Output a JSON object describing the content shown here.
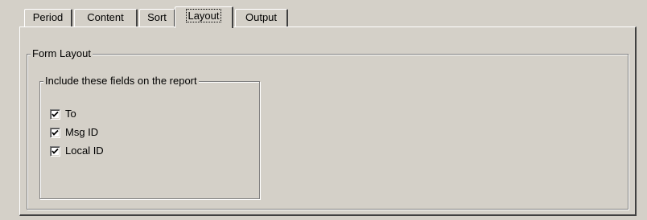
{
  "tabs": [
    {
      "label": "Period",
      "selected": false
    },
    {
      "label": "Content",
      "selected": false
    },
    {
      "label": "Sort",
      "selected": false
    },
    {
      "label": "Layout",
      "selected": true
    },
    {
      "label": "Output",
      "selected": false
    }
  ],
  "form_layout": {
    "title": "Form Layout",
    "fields_group": {
      "title": "Include these fields on the report",
      "checkboxes": [
        {
          "label": "To",
          "checked": true
        },
        {
          "label": "Msg ID",
          "checked": true
        },
        {
          "label": "Local ID",
          "checked": true
        }
      ]
    }
  },
  "colors": {
    "face": "#d4d0c8",
    "highlight": "#ffffff",
    "shadow": "#808080",
    "dark_shadow": "#404040"
  }
}
